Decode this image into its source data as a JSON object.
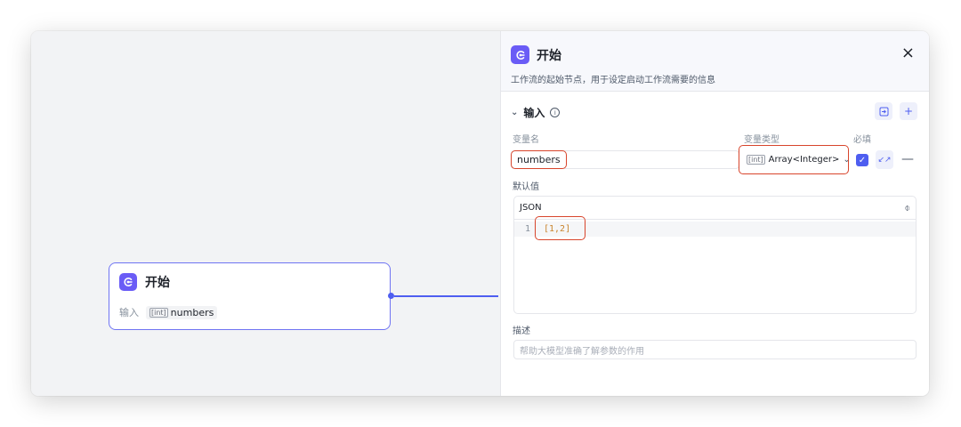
{
  "canvas": {
    "node": {
      "title": "开始",
      "input_label": "输入",
      "input_type_icon": "[int]",
      "input_name": "numbers"
    }
  },
  "panel": {
    "title": "开始",
    "close_icon": "×",
    "description": "工作流的起始节点，用于设定启动工作流需要的信息",
    "section_title": "输入",
    "columns": {
      "name": "变量名",
      "type": "变量类型",
      "required": "必填"
    },
    "variable": {
      "name": "numbers",
      "type_icon": "[int]",
      "type": "Array<Integer>",
      "required": true
    },
    "default_label": "默认值",
    "json": {
      "header": "JSON",
      "line_number": "1",
      "code": "[1,2]"
    },
    "description_label": "描述",
    "description_placeholder": "帮助大模型准确了解参数的作用"
  },
  "colors": {
    "accent": "#4e5ef0",
    "highlight": "#d8452c",
    "node_border": "#6f74f3"
  }
}
